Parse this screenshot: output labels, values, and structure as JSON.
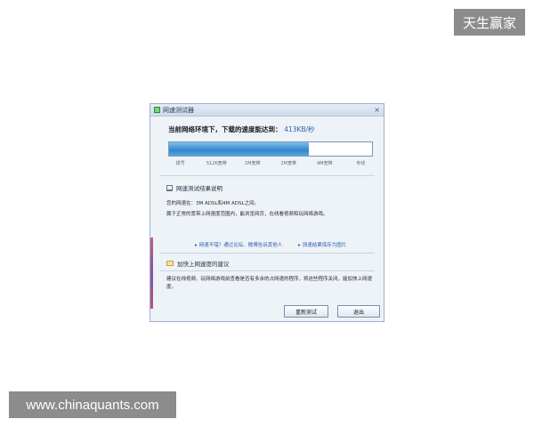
{
  "watermarks": {
    "top_right": "天生赢家",
    "bottom_left": "www.chinaquants.com"
  },
  "window": {
    "title": "网速测试器",
    "close_label": "×"
  },
  "headline": {
    "label": "当前网络环境下，下载的速度能达到：",
    "speed": "413KB/秒"
  },
  "progress": {
    "fraction": 0.69,
    "scale_labels": [
      "拨号",
      "512K宽带",
      "1M宽带",
      "2M宽带",
      "4M宽带",
      "专线"
    ]
  },
  "result_section": {
    "title": "网速测试结果说明",
    "line1": "您的网速在：3M ADSL和4M ADSL之间。",
    "line2": "属于正常的宽带上网速度范围内，能浏览网页，在线看视频和玩网络游戏。"
  },
  "links": {
    "share": "网速不错？通过论坛、微博告诉其他人",
    "save": "测速结果保存为图片"
  },
  "tips_section": {
    "title": "加快上网速度的建议",
    "text": "建议在线视频、玩网络游戏前查看是否有多余的占网速的程序，将这些程序关闭，能加快上网速度。"
  },
  "buttons": {
    "retest": "重新测试",
    "exit": "退出"
  },
  "colors": {
    "accent": "#2f86c9",
    "link": "#2a5fb0"
  }
}
